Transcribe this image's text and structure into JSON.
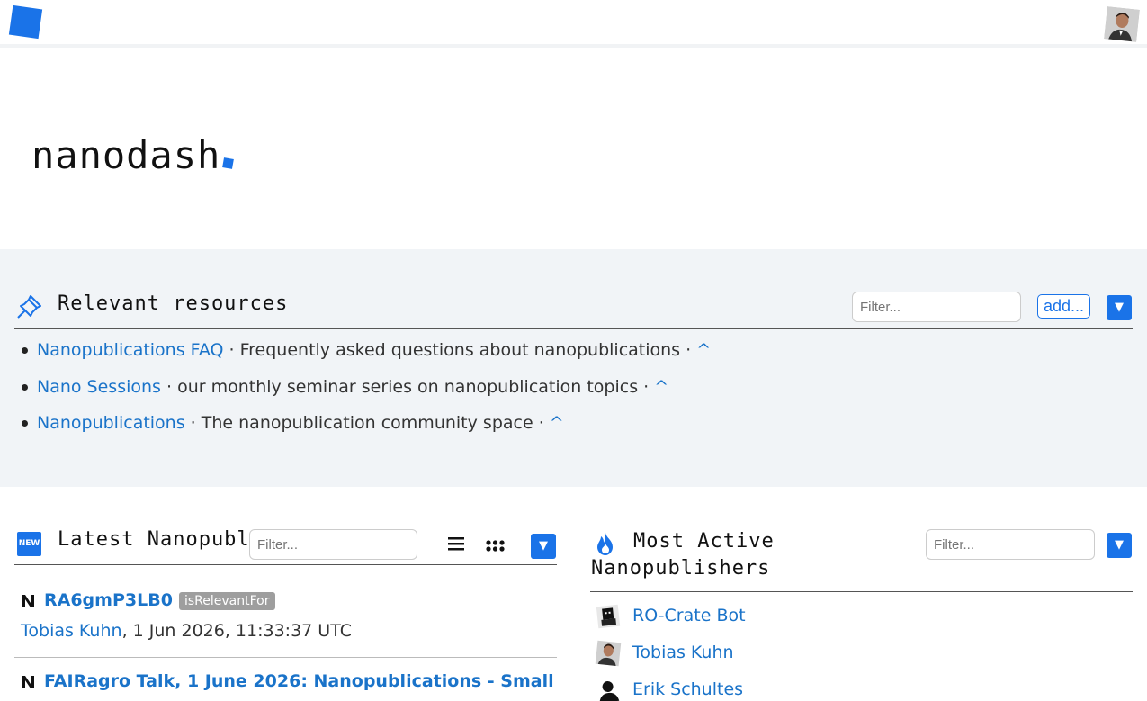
{
  "app": {
    "name": "nanodash"
  },
  "topbar": {
    "logo_icon": "nanodash-logo-icon",
    "avatar_icon": "user-avatar-icon"
  },
  "relevant_resources": {
    "title": "Relevant resources",
    "icon": "pin-icon",
    "filter_placeholder": "Filter...",
    "add_label": "add...",
    "menu_label": "▼",
    "items": [
      {
        "link": "Nanopublications FAQ",
        "description": " · Frequently asked questions about nanopublications · ",
        "up": "^"
      },
      {
        "link": "Nano Sessions",
        "description": " · our monthly seminar series on nanopublication topics · ",
        "up": "^"
      },
      {
        "link": "Nanopublications",
        "description": " · The nanopublication community space · ",
        "up": "^"
      }
    ]
  },
  "latest_nanopubs": {
    "title": "Latest Nanopublications",
    "badge": "NEW",
    "filter_placeholder": "Filter...",
    "list_view_icon": "list-view-icon",
    "grid_view_icon": "grid-view-icon",
    "menu_label": "▼",
    "items": [
      {
        "title": "RA6gmP3LB0",
        "tag": "isRelevantFor",
        "author": "Tobias Kuhn",
        "date": ", 1 Jun 2026, 11:33:37 UTC"
      },
      {
        "title": "FAIRagro Talk, 1 June 2026: Nanopublications - Small"
      }
    ]
  },
  "most_active": {
    "title_line1": "Most Active",
    "title_line2": "Nanopublishers",
    "icon": "flame-icon",
    "filter_placeholder": "Filter...",
    "menu_label": "▼",
    "publishers": [
      {
        "name": "RO-Crate Bot",
        "icon": "bot-avatar-icon"
      },
      {
        "name": "Tobias Kuhn",
        "icon": "user-photo-icon"
      },
      {
        "name": "Erik Schultes",
        "icon": "user-silhouette-icon"
      }
    ]
  },
  "colors": {
    "accent": "#1a73e8",
    "link": "#1a73c9",
    "band": "#f1f4f7",
    "tag": "#9e9e9e"
  }
}
